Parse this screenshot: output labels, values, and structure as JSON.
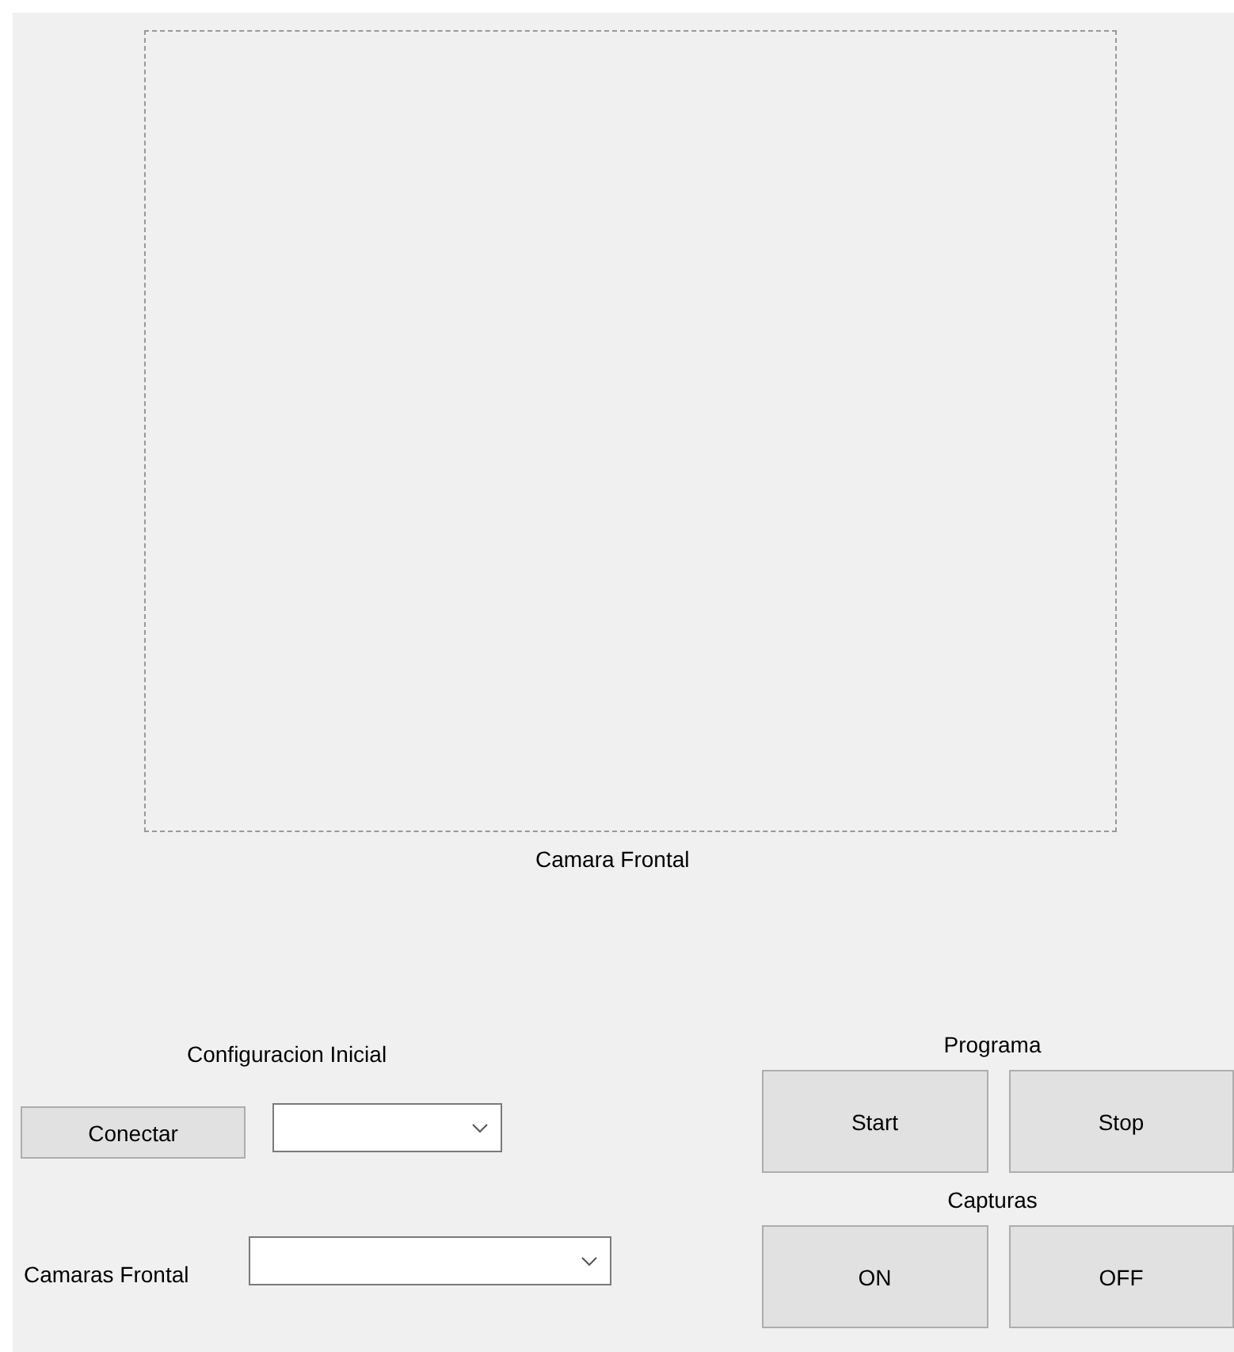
{
  "camera": {
    "caption": "Camara Frontal"
  },
  "config": {
    "title": "Configuracion Inicial",
    "connect_button": "Conectar",
    "camera_label": "Camaras Frontal"
  },
  "program": {
    "title": "Programa",
    "buttons": [
      "Start",
      "Stop"
    ]
  },
  "captures": {
    "title": "Capturas",
    "buttons": [
      "ON",
      "OFF"
    ]
  }
}
